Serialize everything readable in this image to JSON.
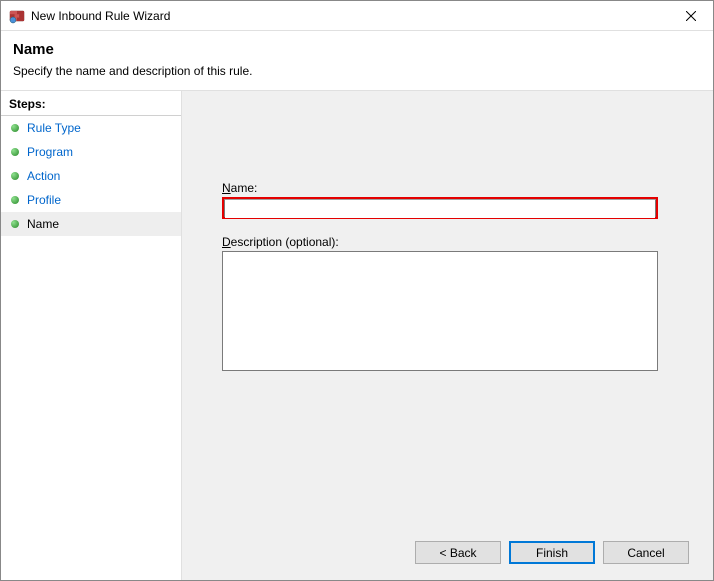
{
  "window": {
    "title": "New Inbound Rule Wizard"
  },
  "header": {
    "title": "Name",
    "description": "Specify the name and description of this rule."
  },
  "steps": {
    "label": "Steps:",
    "items": [
      {
        "label": "Rule Type"
      },
      {
        "label": "Program"
      },
      {
        "label": "Action"
      },
      {
        "label": "Profile"
      },
      {
        "label": "Name"
      }
    ]
  },
  "form": {
    "name_label_prefix": "N",
    "name_label_rest": "ame:",
    "name_value": "",
    "desc_label_prefix": "D",
    "desc_label_rest": "escription (optional):",
    "desc_value": ""
  },
  "buttons": {
    "back": "< Back",
    "finish": "Finish",
    "cancel": "Cancel"
  }
}
